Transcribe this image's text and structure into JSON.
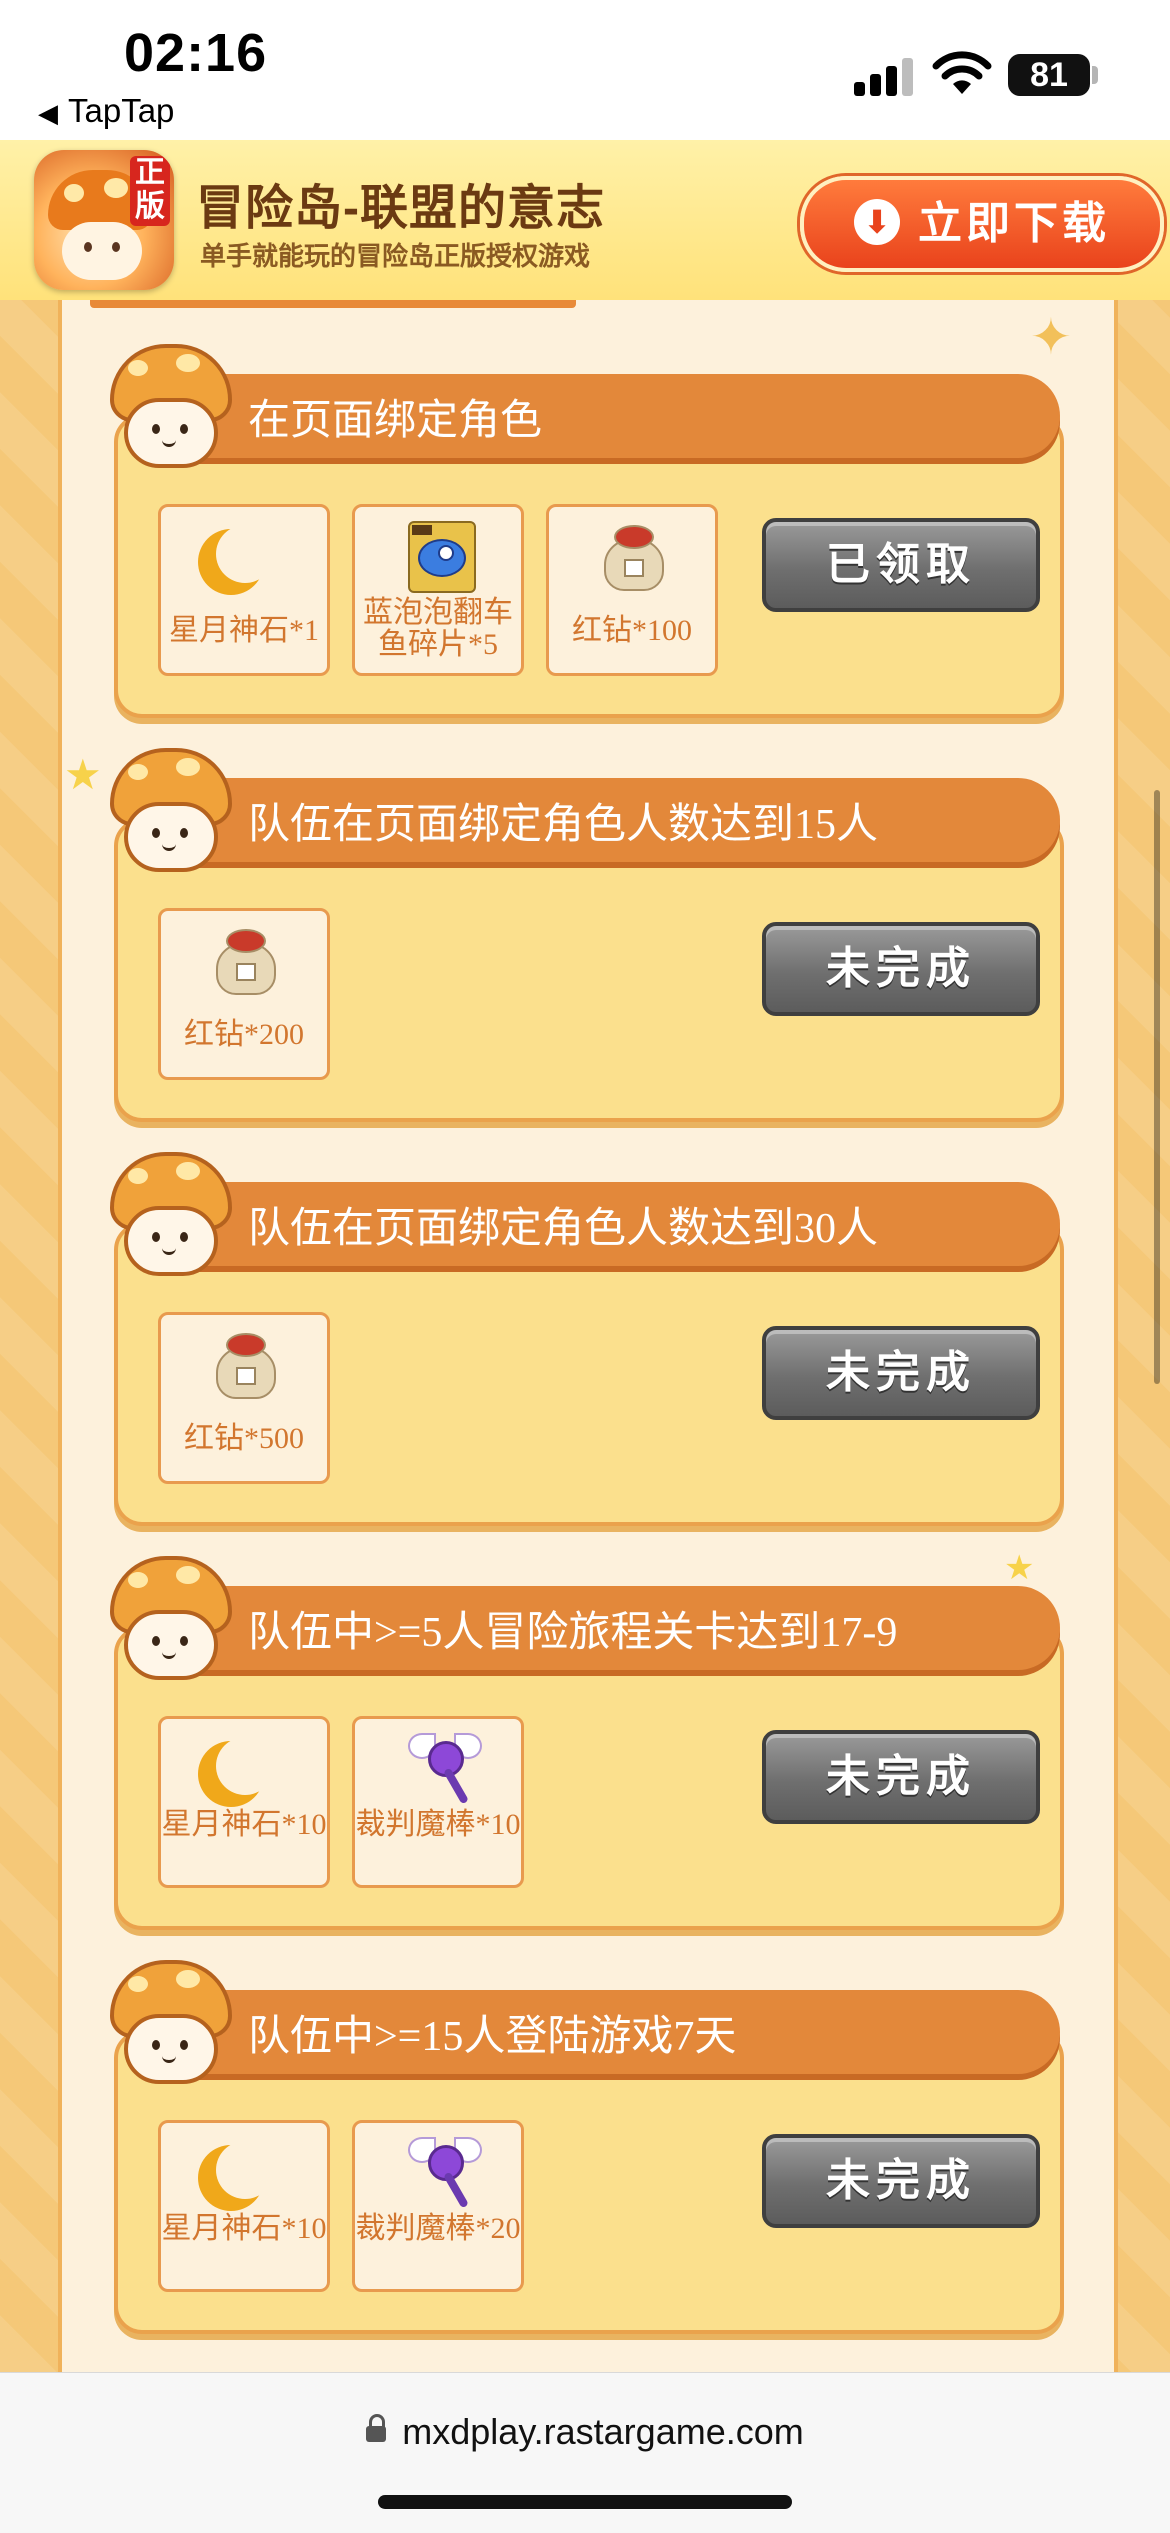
{
  "status_bar": {
    "time": "02:16",
    "back_app": "TapTap",
    "battery": "81"
  },
  "banner": {
    "title": "冒险岛-联盟的意志",
    "subtitle": "单手就能玩的冒险岛正版授权游戏",
    "icon_badge": "正版",
    "download_label": "立即下载"
  },
  "tasks": [
    {
      "title": "在页面绑定角色",
      "rewards": [
        {
          "icon": "moon-stone-icon",
          "label": "星月神石*1"
        },
        {
          "icon": "fish-fragment-icon",
          "label": "蓝泡泡翻车鱼碎片*5"
        },
        {
          "icon": "red-diamond-bag-icon",
          "label": "红钻*100"
        }
      ],
      "status": "已领取"
    },
    {
      "title": "队伍在页面绑定角色人数达到15人",
      "rewards": [
        {
          "icon": "red-diamond-bag-icon",
          "label": "红钻*200"
        }
      ],
      "status": "未完成"
    },
    {
      "title": "队伍在页面绑定角色人数达到30人",
      "rewards": [
        {
          "icon": "red-diamond-bag-icon",
          "label": "红钻*500"
        }
      ],
      "status": "未完成"
    },
    {
      "title": "队伍中>=5人冒险旅程关卡达到17-9",
      "rewards": [
        {
          "icon": "moon-stone-icon",
          "label": "星月神石*10"
        },
        {
          "icon": "judge-wand-icon",
          "label": "裁判魔棒*10"
        }
      ],
      "status": "未完成"
    },
    {
      "title": "队伍中>=15人登陆游戏7天",
      "rewards": [
        {
          "icon": "moon-stone-icon",
          "label": "星月神石*10"
        },
        {
          "icon": "judge-wand-icon",
          "label": "裁判魔棒*20"
        }
      ],
      "status": "未完成"
    }
  ],
  "address_bar": {
    "url": "mxdplay.rastargame.com"
  }
}
